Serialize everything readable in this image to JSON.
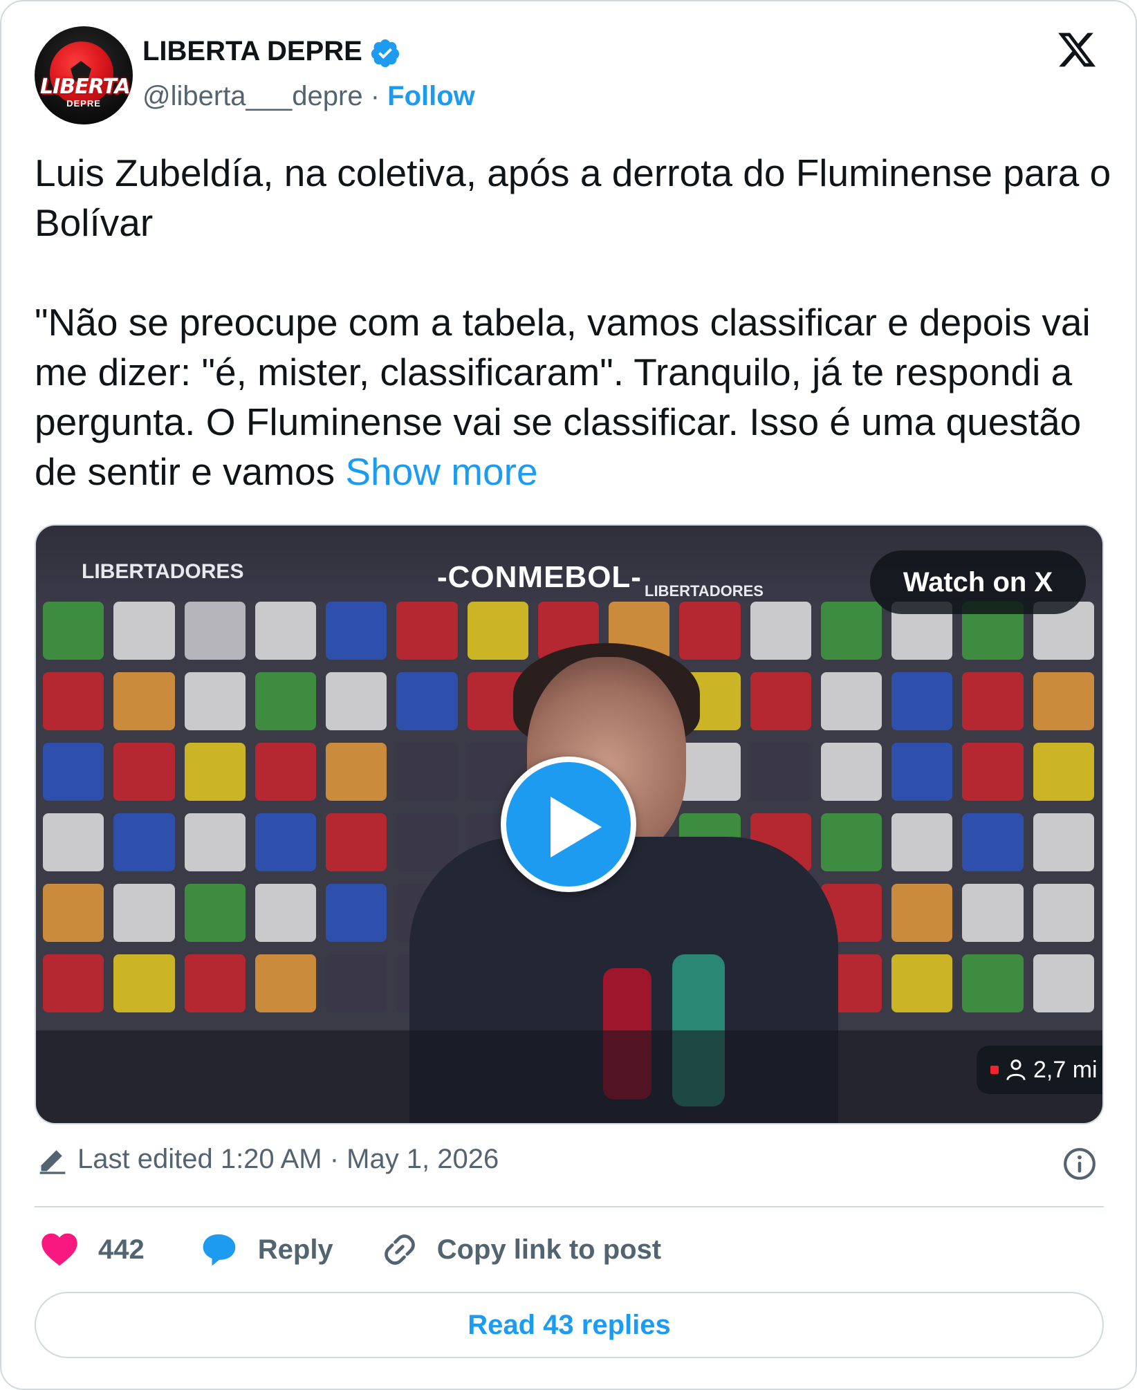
{
  "author": {
    "name": "LIBERTA DEPRE",
    "handle": "@liberta___depre",
    "separator": " · ",
    "follow_label": "Follow",
    "avatar_text": "LIBERTA",
    "avatar_subtext": "DEPRE"
  },
  "post": {
    "text": "Luis Zubeldía, na coletiva, após a derrota do Fluminense para o Bolívar\n\n\"Não se preocupe com a tabela, vamos classificar e depois vai me dizer: \"é, mister, classificaram\". Tranquilo, já te respondi a pergunta. O Fluminense vai se classificar. Isso é uma questão de sentir e vamos ",
    "show_more": "Show more"
  },
  "media": {
    "watch_label": "Watch on X",
    "viewers": "2,7 mi",
    "banner_left": "LIBERTADORES",
    "banner_center": "-CONMEBOL-",
    "banner_right": "LIBERTADORES"
  },
  "meta": {
    "edited": "Last edited 1:20 AM · May 1, 2026"
  },
  "actions": {
    "likes": "442",
    "reply": "Reply",
    "copy_link": "Copy link to post"
  },
  "footer": {
    "read_replies": "Read 43 replies"
  },
  "colors": {
    "accent": "#1d9bf0",
    "like": "#f91880",
    "text": "#0f1419",
    "muted": "#536471"
  }
}
